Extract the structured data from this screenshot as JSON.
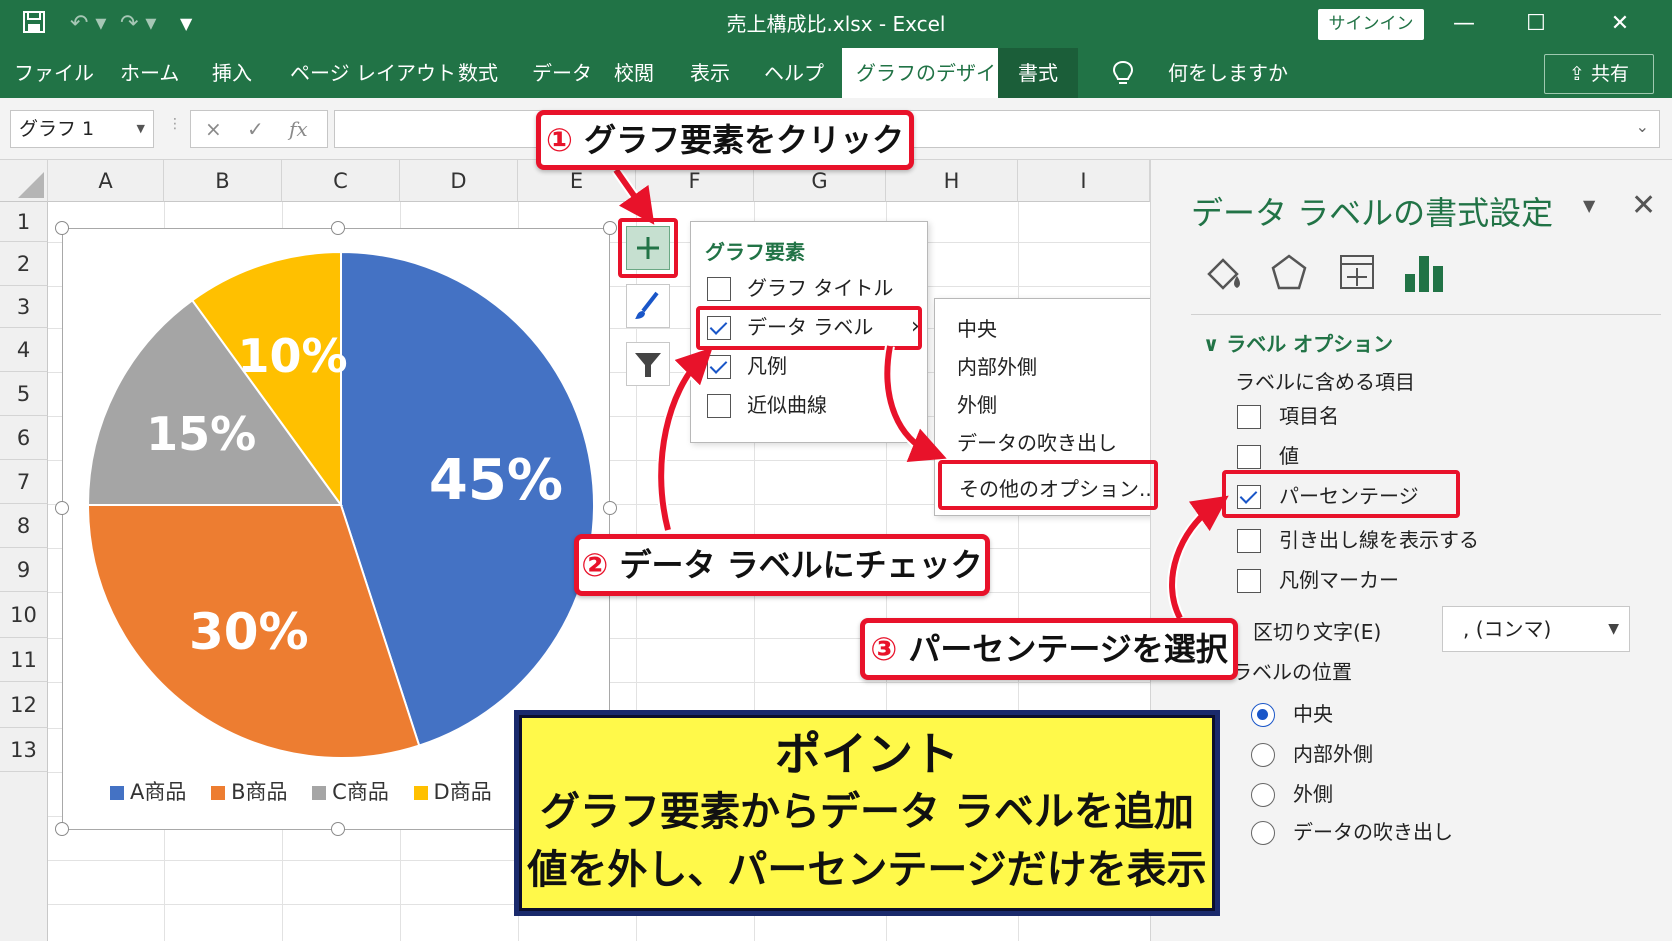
{
  "window": {
    "title": "売上構成比.xlsx  -  Excel",
    "signin": "サインイン",
    "minimize": "—",
    "maximize": "☐",
    "close": "✕"
  },
  "ribbon": {
    "tabs": [
      "ファイル",
      "ホーム",
      "挿入",
      "ページ レイアウト",
      "数式",
      "データ",
      "校閲",
      "表示",
      "ヘルプ",
      "グラフのデザイン",
      "書式"
    ],
    "active_tab": "グラフのデザイン",
    "tell_me": "何をしますか",
    "share": "共有"
  },
  "formula_bar": {
    "name_box": "グラフ 1",
    "cancel": "×",
    "enter": "✓",
    "fx": "fx",
    "value": ""
  },
  "grid": {
    "columns": [
      "A",
      "B",
      "C",
      "D",
      "E",
      "F",
      "G",
      "H",
      "I"
    ],
    "rows": [
      "1",
      "2",
      "3",
      "4",
      "5",
      "6",
      "7",
      "8",
      "9",
      "10",
      "11",
      "12",
      "13"
    ]
  },
  "chart_data": {
    "type": "pie",
    "categories": [
      "A商品",
      "B商品",
      "C商品",
      "D商品"
    ],
    "values": [
      45,
      30,
      15,
      10
    ],
    "labels": [
      "45%",
      "30%",
      "15%",
      "10%"
    ],
    "colors": [
      "#4472c4",
      "#ed7d31",
      "#a5a5a5",
      "#ffc000"
    ],
    "legend_position": "bottom"
  },
  "chart_elements_popup": {
    "title": "グラフ要素",
    "items": [
      {
        "label": "グラフ タイトル",
        "checked": false
      },
      {
        "label": "データ ラベル",
        "checked": true
      },
      {
        "label": "凡例",
        "checked": true
      },
      {
        "label": "近似曲線",
        "checked": false
      }
    ],
    "submenu": [
      "中央",
      "内部外側",
      "外側",
      "データの吹き出し",
      "その他のオプション..."
    ]
  },
  "format_pane": {
    "title": "データ ラベルの書式設定",
    "section": "ラベル オプション",
    "contains_heading": "ラベルに含める項目",
    "contains": [
      {
        "label": "項目名",
        "checked": false
      },
      {
        "label": "値",
        "checked": false
      },
      {
        "label": "パーセンテージ",
        "checked": true
      },
      {
        "label": "引き出し線を表示する",
        "checked": false
      },
      {
        "label": "凡例マーカー",
        "checked": false
      }
    ],
    "separator_label": "区切り文字(E)",
    "separator_value": ", (コンマ)",
    "position_heading": "ラベルの位置",
    "positions": [
      {
        "label": "中央",
        "selected": true
      },
      {
        "label": "内部外側",
        "selected": false
      },
      {
        "label": "外側",
        "selected": false
      },
      {
        "label": "データの吹き出し",
        "selected": false
      }
    ]
  },
  "callouts": {
    "step1_num": "①",
    "step1": "グラフ要素をクリック",
    "step2_num": "②",
    "step2": "データ ラベルにチェック",
    "step3_num": "③",
    "step3": "パーセンテージを選択",
    "point_title": "ポイント",
    "point_line1": "グラフ要素からデータ ラベルを追加",
    "point_line2": "値を外し、パーセンテージだけを表示"
  },
  "colors": {
    "excel_green": "#217346",
    "callout_red": "#e8122a",
    "point_yellow": "#fff94a"
  }
}
